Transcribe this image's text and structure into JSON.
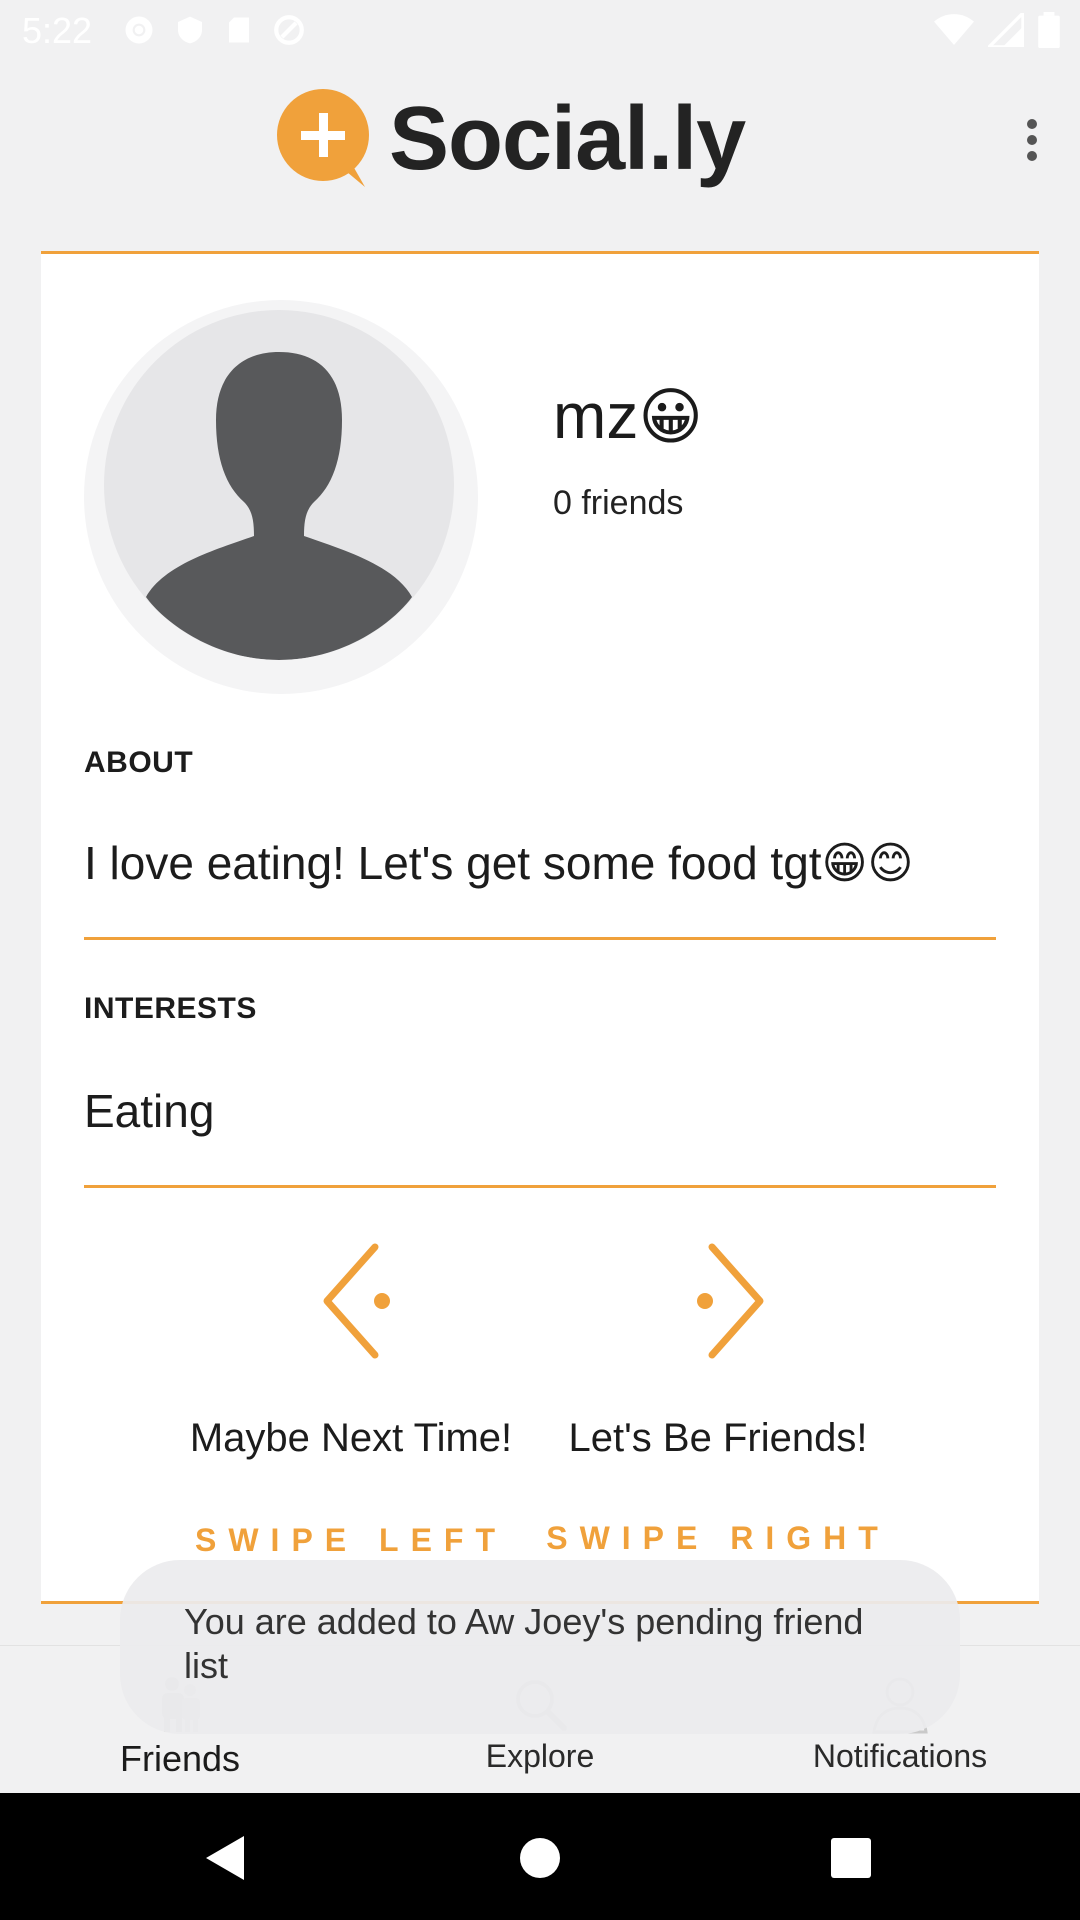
{
  "status_bar": {
    "time": "5:22",
    "left_icons": [
      "settings-icon",
      "shield-icon",
      "sd-card-icon",
      "data-saver-icon"
    ],
    "right_icons": [
      "wifi-icon",
      "cell-signal-icon",
      "battery-icon"
    ]
  },
  "app_bar": {
    "logo_text": "Social.ly",
    "logo_badge": "+",
    "menu_icon": "more-vert-icon"
  },
  "profile": {
    "name": "mz",
    "name_emoji": "😀",
    "friends_count": "0 friends",
    "about_label": "ABOUT",
    "about_text": "I love eating! Let's get some food tgt",
    "about_emojis": "😁😊",
    "interests_label": "INTERESTS",
    "interests_text": "Eating"
  },
  "actions": {
    "left": {
      "label": "Maybe Next Time!",
      "hint": "SWIPE LEFT",
      "icon": "chevron-left-icon"
    },
    "right": {
      "label": "Let's Be Friends!",
      "hint": "SWIPE RIGHT",
      "icon": "chevron-right-icon"
    }
  },
  "toast": {
    "message": "You are added to Aw Joey's pending friend list"
  },
  "bottom_nav": {
    "items": [
      {
        "label": "Friends",
        "icon": "friends-icon",
        "active": true
      },
      {
        "label": "Explore",
        "icon": "search-icon",
        "active": false
      },
      {
        "label": "Notifications",
        "icon": "person-icon",
        "active": false
      }
    ]
  },
  "system_nav": [
    "back-icon",
    "home-icon",
    "recents-icon"
  ],
  "colors": {
    "accent": "#f0a13b",
    "background": "#f1f1f2",
    "card": "#ffffff"
  }
}
